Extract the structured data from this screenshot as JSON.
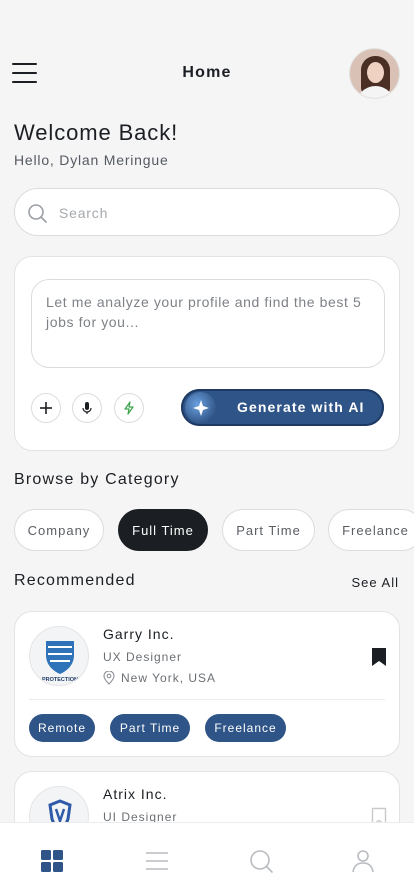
{
  "header": {
    "title": "Home",
    "menu_icon": "hamburger-icon",
    "avatar_icon": "user-avatar"
  },
  "greeting": {
    "title": "Welcome Back!",
    "subtitle": "Hello, Dylan Meringue"
  },
  "search": {
    "placeholder": "Search",
    "value": ""
  },
  "ai_card": {
    "prompt": "Let me analyze your profile and find the best 5 jobs for you...",
    "actions": [
      "plus-icon",
      "microphone-icon",
      "lightning-icon"
    ],
    "generate_label": "Generate with AI",
    "accent": "#2f5487"
  },
  "categories": {
    "title": "Browse by Category",
    "items": [
      {
        "label": "Company",
        "active": false
      },
      {
        "label": "Full Time",
        "active": true
      },
      {
        "label": "Part Time",
        "active": false
      },
      {
        "label": "Freelance",
        "active": false
      }
    ]
  },
  "recommended": {
    "title": "Recommended",
    "see_all": "See All",
    "jobs": [
      {
        "company": "Garry Inc.",
        "role": "UX Designer",
        "location": "New York, USA",
        "bookmarked": true,
        "logo_text": "PROTECTION",
        "tags": [
          "Remote",
          "Part Time",
          "Freelance"
        ]
      },
      {
        "company": "Atrix Inc.",
        "role": "UI Designer",
        "bookmarked": false
      }
    ]
  },
  "bottom_nav": {
    "items": [
      "grid-icon",
      "list-icon",
      "search-icon",
      "profile-icon"
    ],
    "active_index": 0
  }
}
